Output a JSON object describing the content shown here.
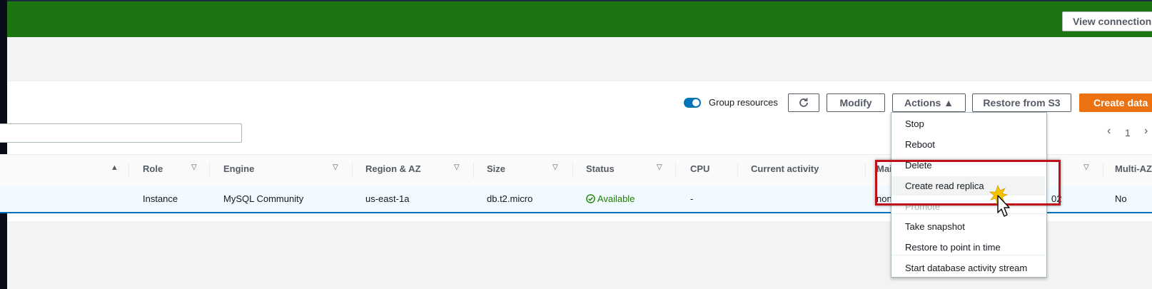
{
  "header": {
    "view_connection_label": "View connection"
  },
  "toolbar": {
    "group_resources_label": "Group resources",
    "group_resources_on": true,
    "refresh_icon": "refresh-icon",
    "modify_label": "Modify",
    "actions_label": "Actions ▲",
    "restore_s3_label": "Restore from S3",
    "create_label": "Create data"
  },
  "search": {
    "placeholder": "",
    "value": ""
  },
  "pagination": {
    "prev_icon": "chevron-left-icon",
    "page": "1",
    "next_icon": "chevron-right-icon"
  },
  "table": {
    "columns": [
      "▲",
      "Role",
      "Engine",
      "Region & AZ",
      "Size",
      "Status",
      "CPU",
      "Current activity",
      "Main",
      "Multi-AZ"
    ],
    "row": {
      "role": "Instance",
      "engine": "MySQL Community",
      "region": "us-east-1a",
      "size": "db.t2.micro",
      "status": "Available",
      "cpu": "-",
      "maintenance": "none",
      "hidden_value": "02",
      "multi_az": "No"
    }
  },
  "actions_menu": {
    "items": [
      "Stop",
      "Reboot",
      "Delete",
      "Create read replica",
      "Promote",
      "Take snapshot",
      "Restore to point in time",
      "Start database activity stream"
    ]
  },
  "colors": {
    "header": "#1d7512",
    "primary": "#ec7211",
    "highlight_box": "#c0101a",
    "accent": "#0073bb"
  }
}
